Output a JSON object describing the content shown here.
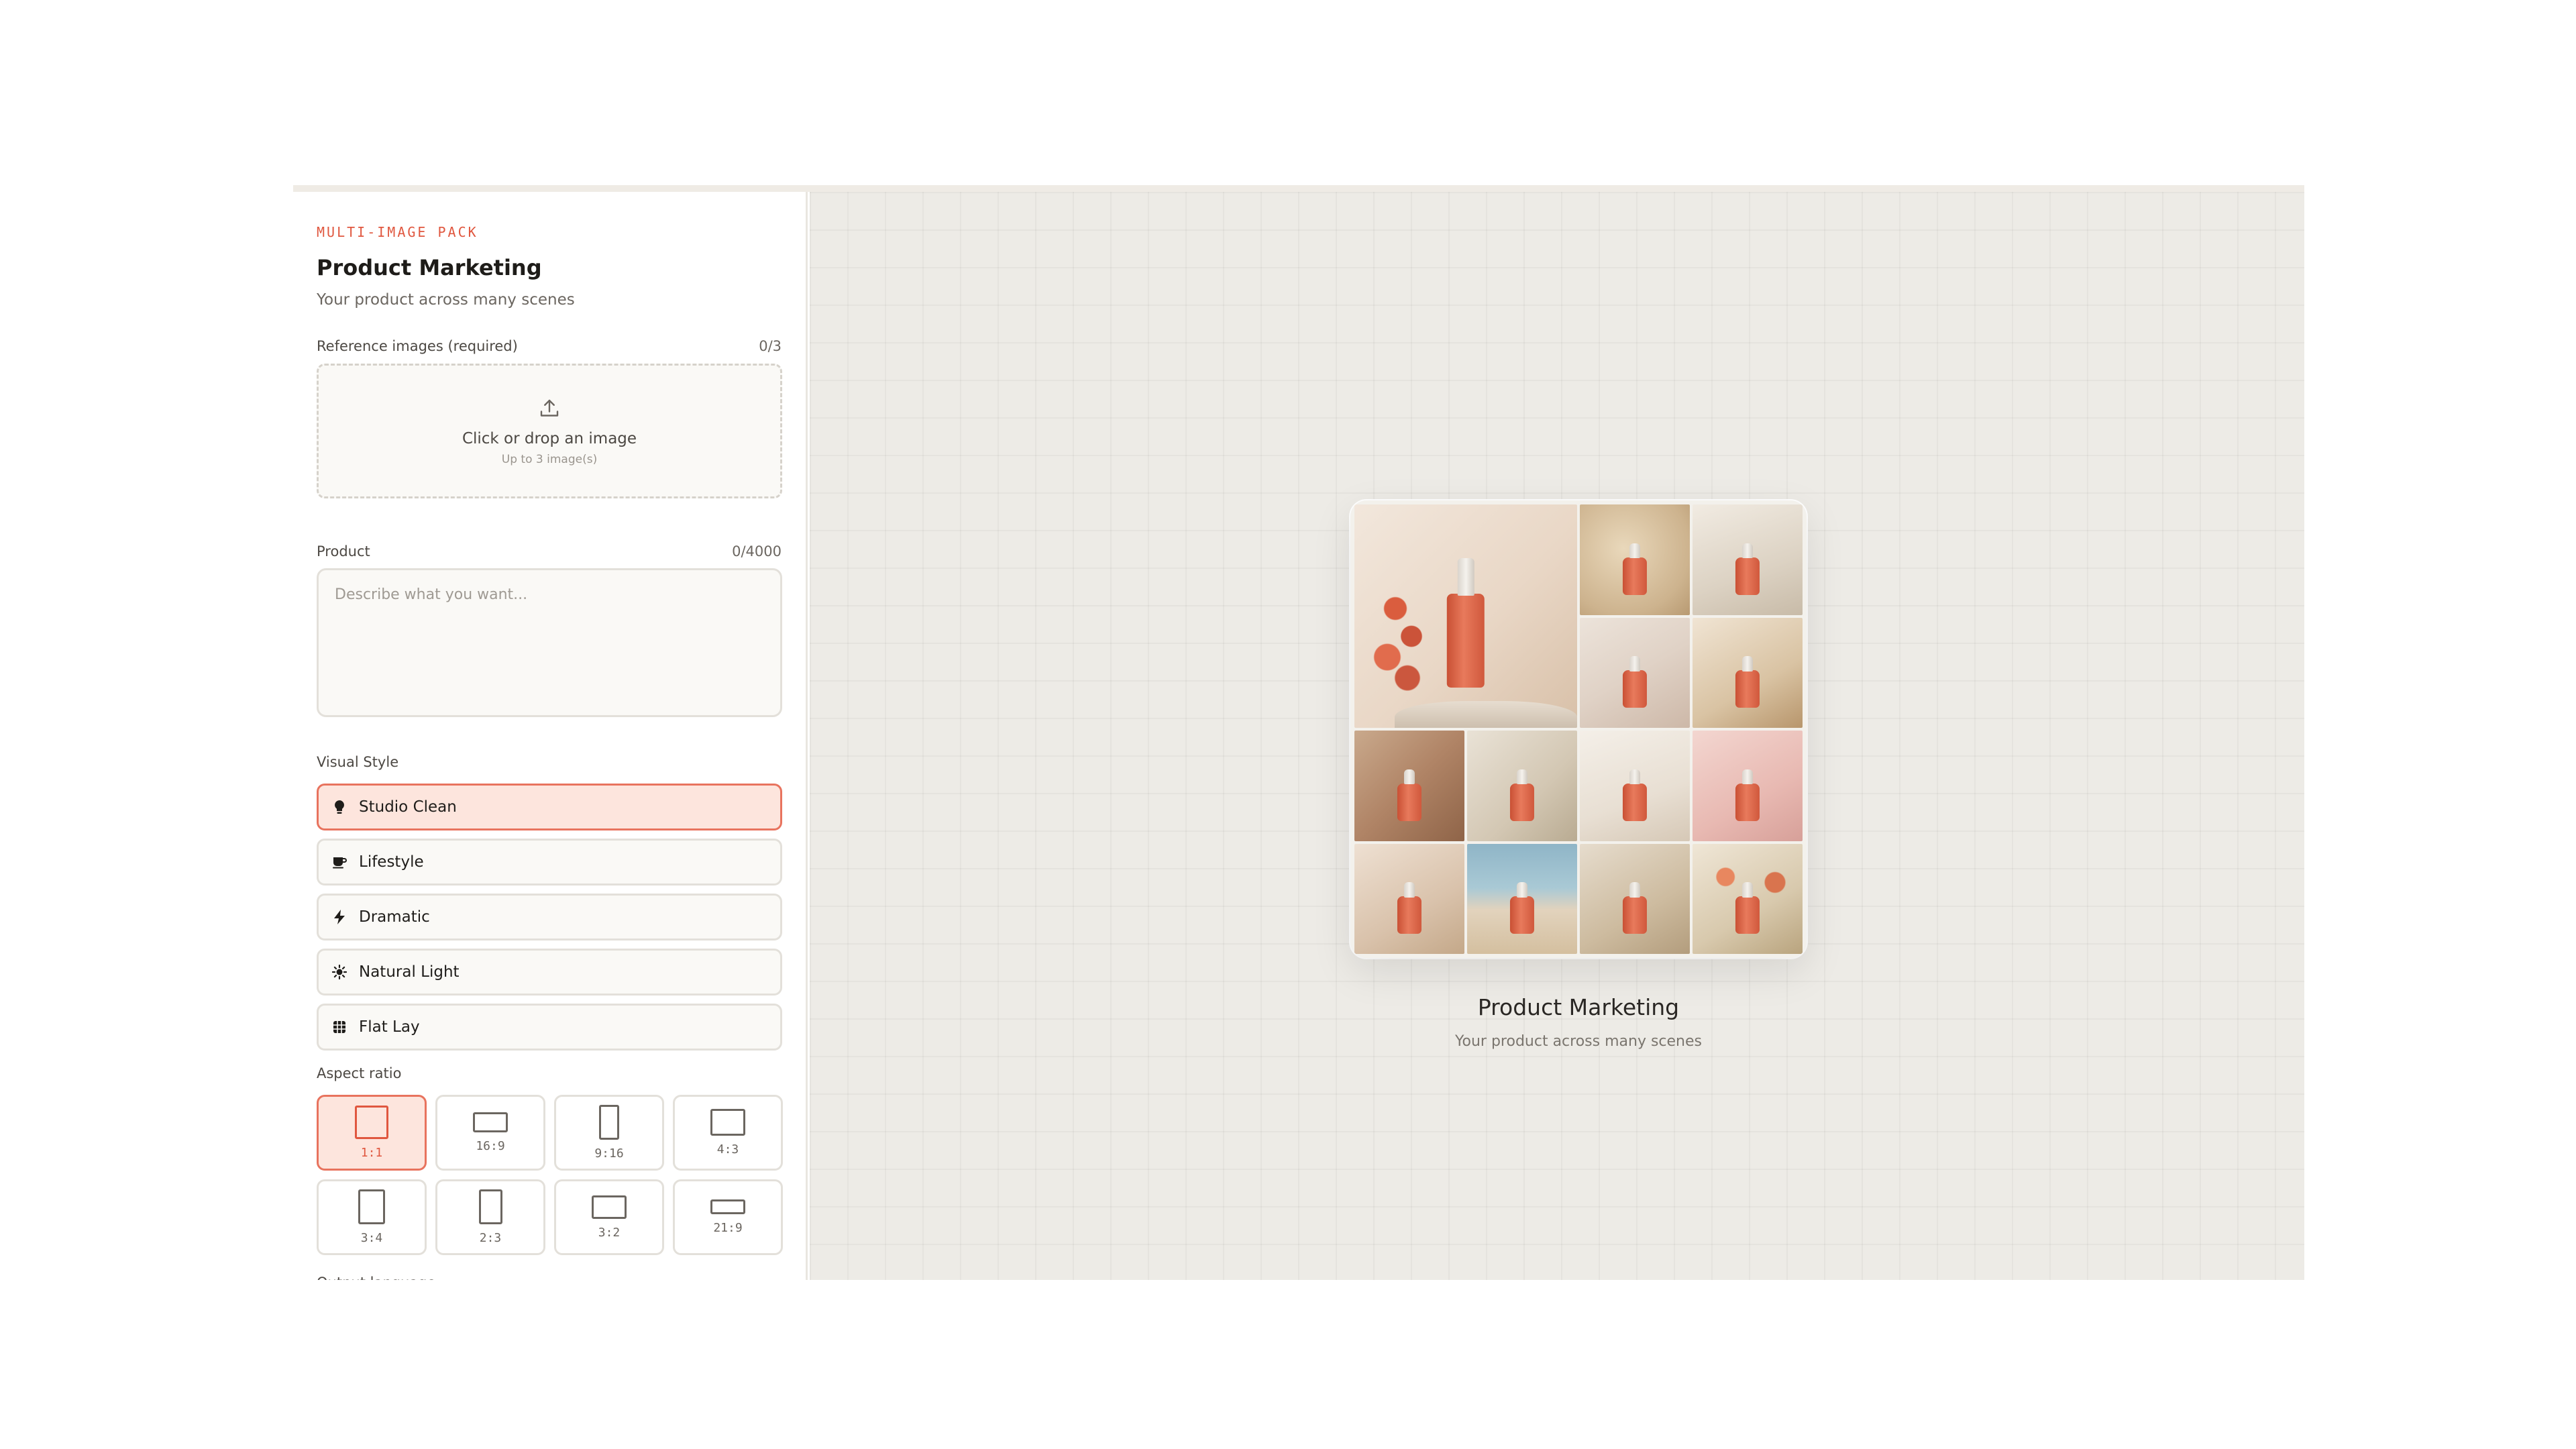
{
  "sidebar": {
    "eyebrow": "MULTI-IMAGE PACK",
    "title": "Product Marketing",
    "subtitle": "Your product across many scenes",
    "reference": {
      "label": "Reference images (required)",
      "count": "0/3",
      "drop_text": "Click or drop an image",
      "drop_sub": "Up to 3 image(s)",
      "icon": "upload-icon"
    },
    "product": {
      "label": "Product",
      "count": "0/4000",
      "placeholder": "Describe what you want...",
      "value": ""
    },
    "visual_style": {
      "label": "Visual Style",
      "options": [
        {
          "label": "Studio Clean",
          "icon": "lightbulb-icon",
          "selected": true
        },
        {
          "label": "Lifestyle",
          "icon": "coffee-cup-icon",
          "selected": false
        },
        {
          "label": "Dramatic",
          "icon": "lightning-icon",
          "selected": false
        },
        {
          "label": "Natural Light",
          "icon": "sun-icon",
          "selected": false
        },
        {
          "label": "Flat Lay",
          "icon": "grid-icon",
          "selected": false
        }
      ]
    },
    "aspect_ratio": {
      "label": "Aspect ratio",
      "options": [
        {
          "label": "1:1",
          "selected": true
        },
        {
          "label": "16:9",
          "selected": false
        },
        {
          "label": "9:16",
          "selected": false
        },
        {
          "label": "4:3",
          "selected": false
        },
        {
          "label": "3:4",
          "selected": false
        },
        {
          "label": "2:3",
          "selected": false
        },
        {
          "label": "3:2",
          "selected": false
        },
        {
          "label": "21:9",
          "selected": false
        }
      ]
    },
    "output_language_label": "Output language"
  },
  "preview": {
    "title": "Product Marketing",
    "subtitle": "Your product across many scenes"
  },
  "colors": {
    "accent": "#e0573f",
    "accent_bg": "#fde5dd",
    "canvas_bg": "#edebe6",
    "bottle": "#e06a4c"
  }
}
